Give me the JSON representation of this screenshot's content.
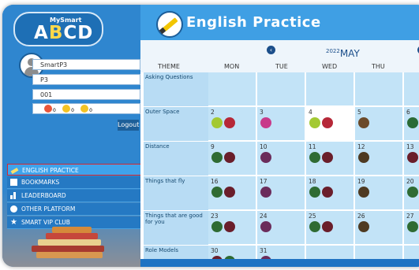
{
  "logo": {
    "small": "MySmart",
    "big_a": "A",
    "big_b": "B",
    "big_c": "C",
    "big_d": "D"
  },
  "user": {
    "username": "SmartP3",
    "level": "P3",
    "class": "001",
    "emoji_counts": [
      "0",
      "0",
      "0"
    ],
    "logout_label": "Logout"
  },
  "menu": [
    {
      "label": "ENGLISH PRACTICE",
      "icon": "pencil-icon"
    },
    {
      "label": "BOOKMARKS",
      "icon": "bookmark-icon"
    },
    {
      "label": "LEADERBOARD",
      "icon": "leaderboard-icon"
    },
    {
      "label": "OTHER PLATFORM",
      "icon": "platform-icon"
    },
    {
      "label": "SMART VIP CLUB",
      "icon": "star-icon"
    }
  ],
  "banner": {
    "title": "English Practice"
  },
  "calendar": {
    "year": "2022",
    "month": "MAY",
    "headers": [
      "THEME",
      "MON",
      "TUE",
      "WED",
      "THU"
    ],
    "rows": [
      {
        "theme": "Asking Questions",
        "days": [
          "",
          "",
          "",
          "",
          ""
        ]
      },
      {
        "theme": "Outer Space",
        "days": [
          "2",
          "3",
          "4",
          "5",
          "6"
        ]
      },
      {
        "theme": "Distance",
        "days": [
          "9",
          "10",
          "11",
          "12",
          "13"
        ]
      },
      {
        "theme": "Things that fly",
        "days": [
          "16",
          "17",
          "18",
          "19",
          "20"
        ]
      },
      {
        "theme": "Things that are good for you",
        "days": [
          "23",
          "24",
          "25",
          "26",
          "27"
        ]
      },
      {
        "theme": "Role Models",
        "days": [
          "30",
          "31",
          "",
          "",
          ""
        ]
      }
    ]
  },
  "colors": {
    "accent": "#3f9fe4",
    "sidebar": "#2f86cf",
    "cell": "#c2e3f7"
  }
}
